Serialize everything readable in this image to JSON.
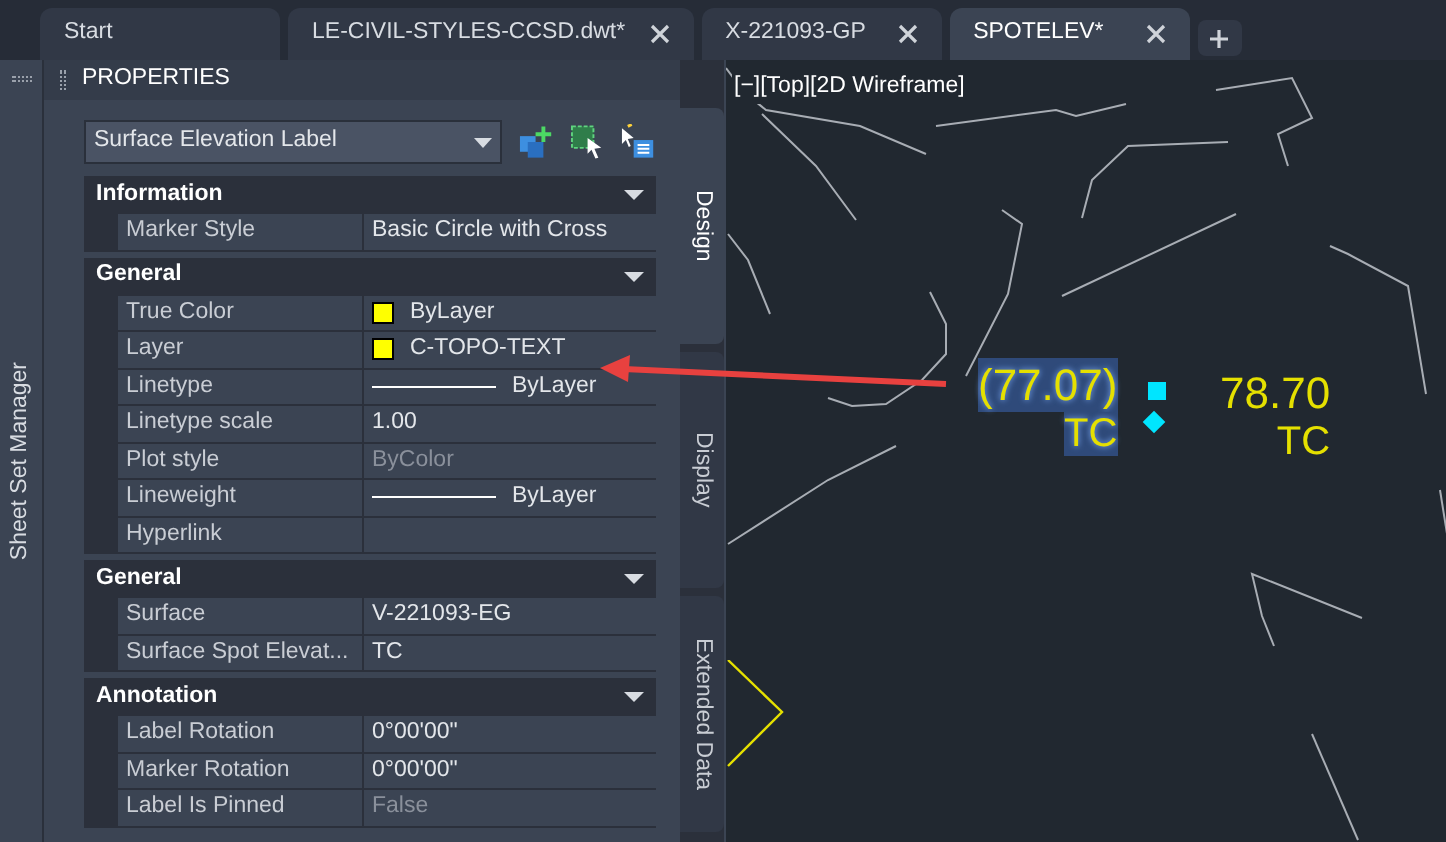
{
  "tabs": [
    {
      "label": "Start",
      "selected": false,
      "closable": false
    },
    {
      "label": "LE-CIVIL-STYLES-CCSD.dwt*",
      "selected": false,
      "closable": true
    },
    {
      "label": "X-221093-GP",
      "selected": false,
      "closable": true
    },
    {
      "label": "SPOTELEV*",
      "selected": true,
      "closable": true
    }
  ],
  "side_palette": {
    "title": "Sheet Set Manager"
  },
  "properties": {
    "title": "PROPERTIES",
    "object_type": "Surface Elevation Label",
    "sections": [
      {
        "title": "Information",
        "expanded": true,
        "rows": [
          {
            "label": "Marker Style",
            "value": "Basic Circle with Cross",
            "kind": "text"
          }
        ]
      },
      {
        "title": "General",
        "expanded": true,
        "rows": [
          {
            "label": "True Color",
            "value": "ByLayer",
            "kind": "swatch",
            "color": "#ffff00"
          },
          {
            "label": "Layer",
            "value": "C-TOPO-TEXT",
            "kind": "swatch",
            "color": "#ffff00"
          },
          {
            "label": "Linetype",
            "value": "ByLayer",
            "kind": "line"
          },
          {
            "label": "Linetype scale",
            "value": "1.00",
            "kind": "text"
          },
          {
            "label": "Plot style",
            "value": "ByColor",
            "kind": "text",
            "disabled": true
          },
          {
            "label": "Lineweight",
            "value": "ByLayer",
            "kind": "line"
          },
          {
            "label": "Hyperlink",
            "kind": "text"
          }
        ]
      },
      {
        "title": "General",
        "expanded": true,
        "rows": [
          {
            "label": "Surface",
            "value": "V-221093-EG",
            "kind": "text"
          },
          {
            "label": "Surface  Spot  Elevat...",
            "value": "TC",
            "kind": "text"
          }
        ]
      },
      {
        "title": "Annotation",
        "expanded": true,
        "rows": [
          {
            "label": "Label Rotation",
            "value": "0°00'00\"",
            "kind": "text"
          },
          {
            "label": "Marker Rotation",
            "value": "0°00'00\"",
            "kind": "text"
          },
          {
            "label": "Label Is Pinned",
            "value": "False",
            "kind": "text",
            "disabled": true
          }
        ]
      }
    ]
  },
  "side_tabs": [
    {
      "label": "Design",
      "selected": true
    },
    {
      "label": "Display",
      "selected": false
    },
    {
      "label": "Extended Data",
      "selected": false
    }
  ],
  "viewport": {
    "controls": "[−][Top][2D Wireframe]",
    "labels": [
      {
        "elevation": "(77.07)",
        "code": "TC",
        "selected": true
      },
      {
        "elevation": "78.70",
        "code": "TC",
        "selected": false
      }
    ]
  }
}
